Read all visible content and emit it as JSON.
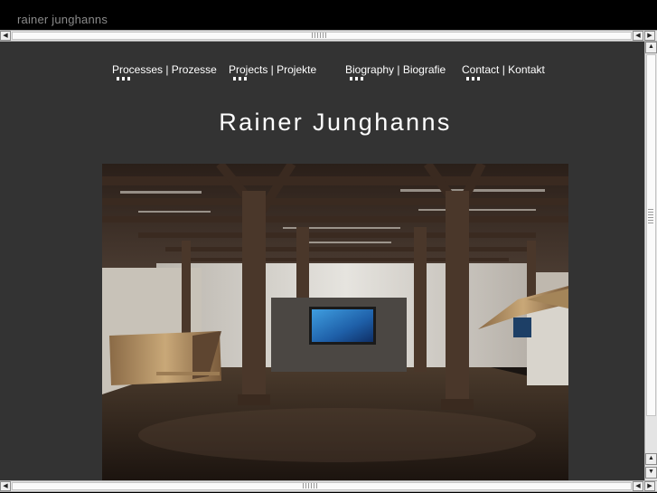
{
  "window": {
    "title": "rainer junghanns"
  },
  "nav": {
    "items": [
      {
        "label": "Processes | Prozesse"
      },
      {
        "label": "Projects | Projekte"
      },
      {
        "label": "Biography | Biografie"
      },
      {
        "label": "Contact | Kontakt"
      }
    ]
  },
  "header": {
    "title": "Rainer Junghanns"
  },
  "colors": {
    "page_background": "#333333",
    "titlebar": "#000000",
    "text": "#ffffff"
  },
  "icons": {
    "scroll_left": "triangle-left-icon",
    "scroll_right": "triangle-right-icon",
    "scroll_up": "triangle-up-icon",
    "scroll_down": "triangle-down-icon"
  }
}
